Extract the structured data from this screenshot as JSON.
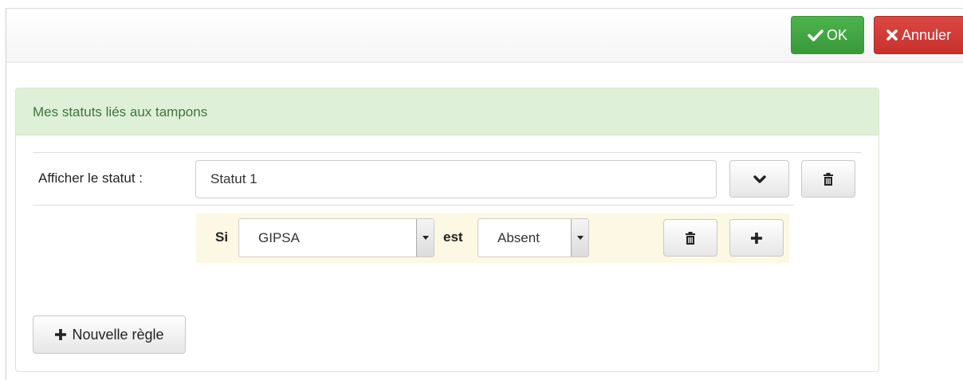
{
  "toolbar": {
    "ok_label": "OK",
    "cancel_label": "Annuler"
  },
  "panel": {
    "title": "Mes statuts liés aux tampons",
    "status_label": "Afficher le statut :",
    "status_value": "Statut 1",
    "rule": {
      "if_label": "Si",
      "field_value": "GIPSA",
      "op_label": "est",
      "state_value": "Absent"
    },
    "new_rule_label": "Nouvelle règle"
  },
  "colors": {
    "ok": "#3a993a",
    "cancel": "#c9302c",
    "panel_heading_bg": "#dff0d8",
    "panel_heading_text": "#3c763d",
    "rule_bg": "#fcf8e3"
  },
  "icons": [
    "check-icon",
    "x-icon",
    "chevron-down-icon",
    "trash-icon",
    "plus-icon",
    "caret-down-icon"
  ]
}
